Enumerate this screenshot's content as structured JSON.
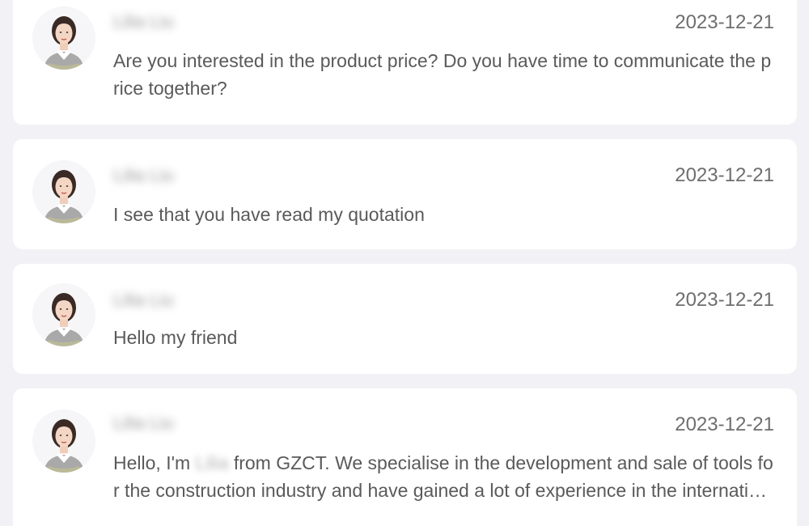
{
  "conversations": [
    {
      "contact_name": "Lilia Liu",
      "date": "2023-12-21",
      "message": "Are you interested in the product price? Do you have time to communicate the price together?"
    },
    {
      "contact_name": "Lilia Liu",
      "date": "2023-12-21",
      "message": "I see that you have read my quotation"
    },
    {
      "contact_name": "Lilia Liu",
      "date": "2023-12-21",
      "message": "Hello my friend"
    },
    {
      "contact_name": "Lilia Liu",
      "date": "2023-12-21",
      "message_prefix": "Hello, I'm ",
      "message_redacted": "Lilia",
      "message_suffix": " from GZCT. We specialise in the development and sale of tools for the construction industry and have gained a lot of experience in the international market..."
    }
  ],
  "icons": {
    "avatar": "contact-avatar-photo"
  },
  "colors": {
    "background": "#f2f2f6",
    "card": "#ffffff",
    "text": "#5a5a5a",
    "date": "#6e6e6e"
  }
}
